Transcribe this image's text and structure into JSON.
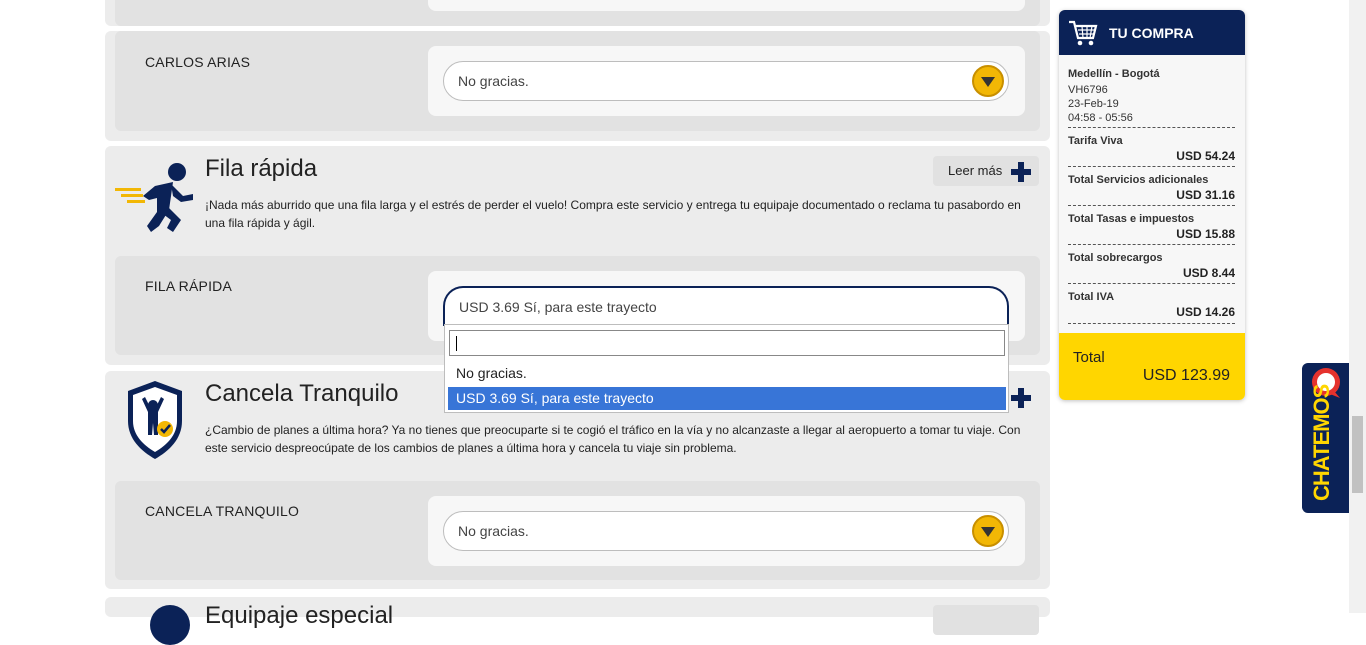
{
  "passengers": {
    "carlos": {
      "name": "CARLOS ARIAS",
      "selected": "No gracias."
    }
  },
  "sections": {
    "fila_rapida": {
      "title": "Fila rápida",
      "description": "¡Nada más aburrido que una fila larga y el estrés de perder el vuelo! Compra este servicio y entrega tu equipaje documentado o reclama tu pasabordo en una fila rápida y ágil.",
      "leer_mas": "Leer más",
      "field_label": "FILA RÁPIDA",
      "selected": "USD 3.69 Sí, para este trayecto",
      "search_value": "",
      "options": [
        "No gracias.",
        "USD 3.69 Sí, para este trayecto"
      ]
    },
    "cancela": {
      "title": "Cancela Tranquilo",
      "description": "¿Cambio de planes a última hora? Ya no tienes que preocuparte si te cogió el tráfico en la vía y no alcanzaste a llegar al aeropuerto a tomar tu viaje. Con este servicio despreocúpate de los cambios de planes a última hora y cancela tu viaje sin problema.",
      "field_label": "CANCELA TRANQUILO",
      "selected": "No gracias."
    },
    "next": {
      "title": "Equipaje especial"
    }
  },
  "cart": {
    "title": "TU COMPRA",
    "route": "Medellín - Bogotá",
    "flight": "VH6796",
    "date": "23-Feb-19",
    "time": "04:58 - 05:56",
    "lines": [
      {
        "label": "Tarifa Viva",
        "amount": "USD 54.24"
      },
      {
        "label": "Total Servicios adicionales",
        "amount": "USD 31.16"
      },
      {
        "label": "Total Tasas e impuestos",
        "amount": "USD 15.88"
      },
      {
        "label": "Total sobrecargos",
        "amount": "USD 8.44"
      },
      {
        "label": "Total IVA",
        "amount": "USD 14.26"
      }
    ],
    "total_label": "Total",
    "total_amount": "USD 123.99"
  },
  "chat": {
    "label": "CHATEMOS"
  },
  "colors": {
    "navy": "#0b2257",
    "yellow": "#ffd600",
    "select_blue": "#3875d7"
  },
  "icons": [
    "runner-icon",
    "shield-person-icon",
    "cart-icon",
    "chat-bubble-icon",
    "plus-icon",
    "dropdown-arrow-icon"
  ]
}
